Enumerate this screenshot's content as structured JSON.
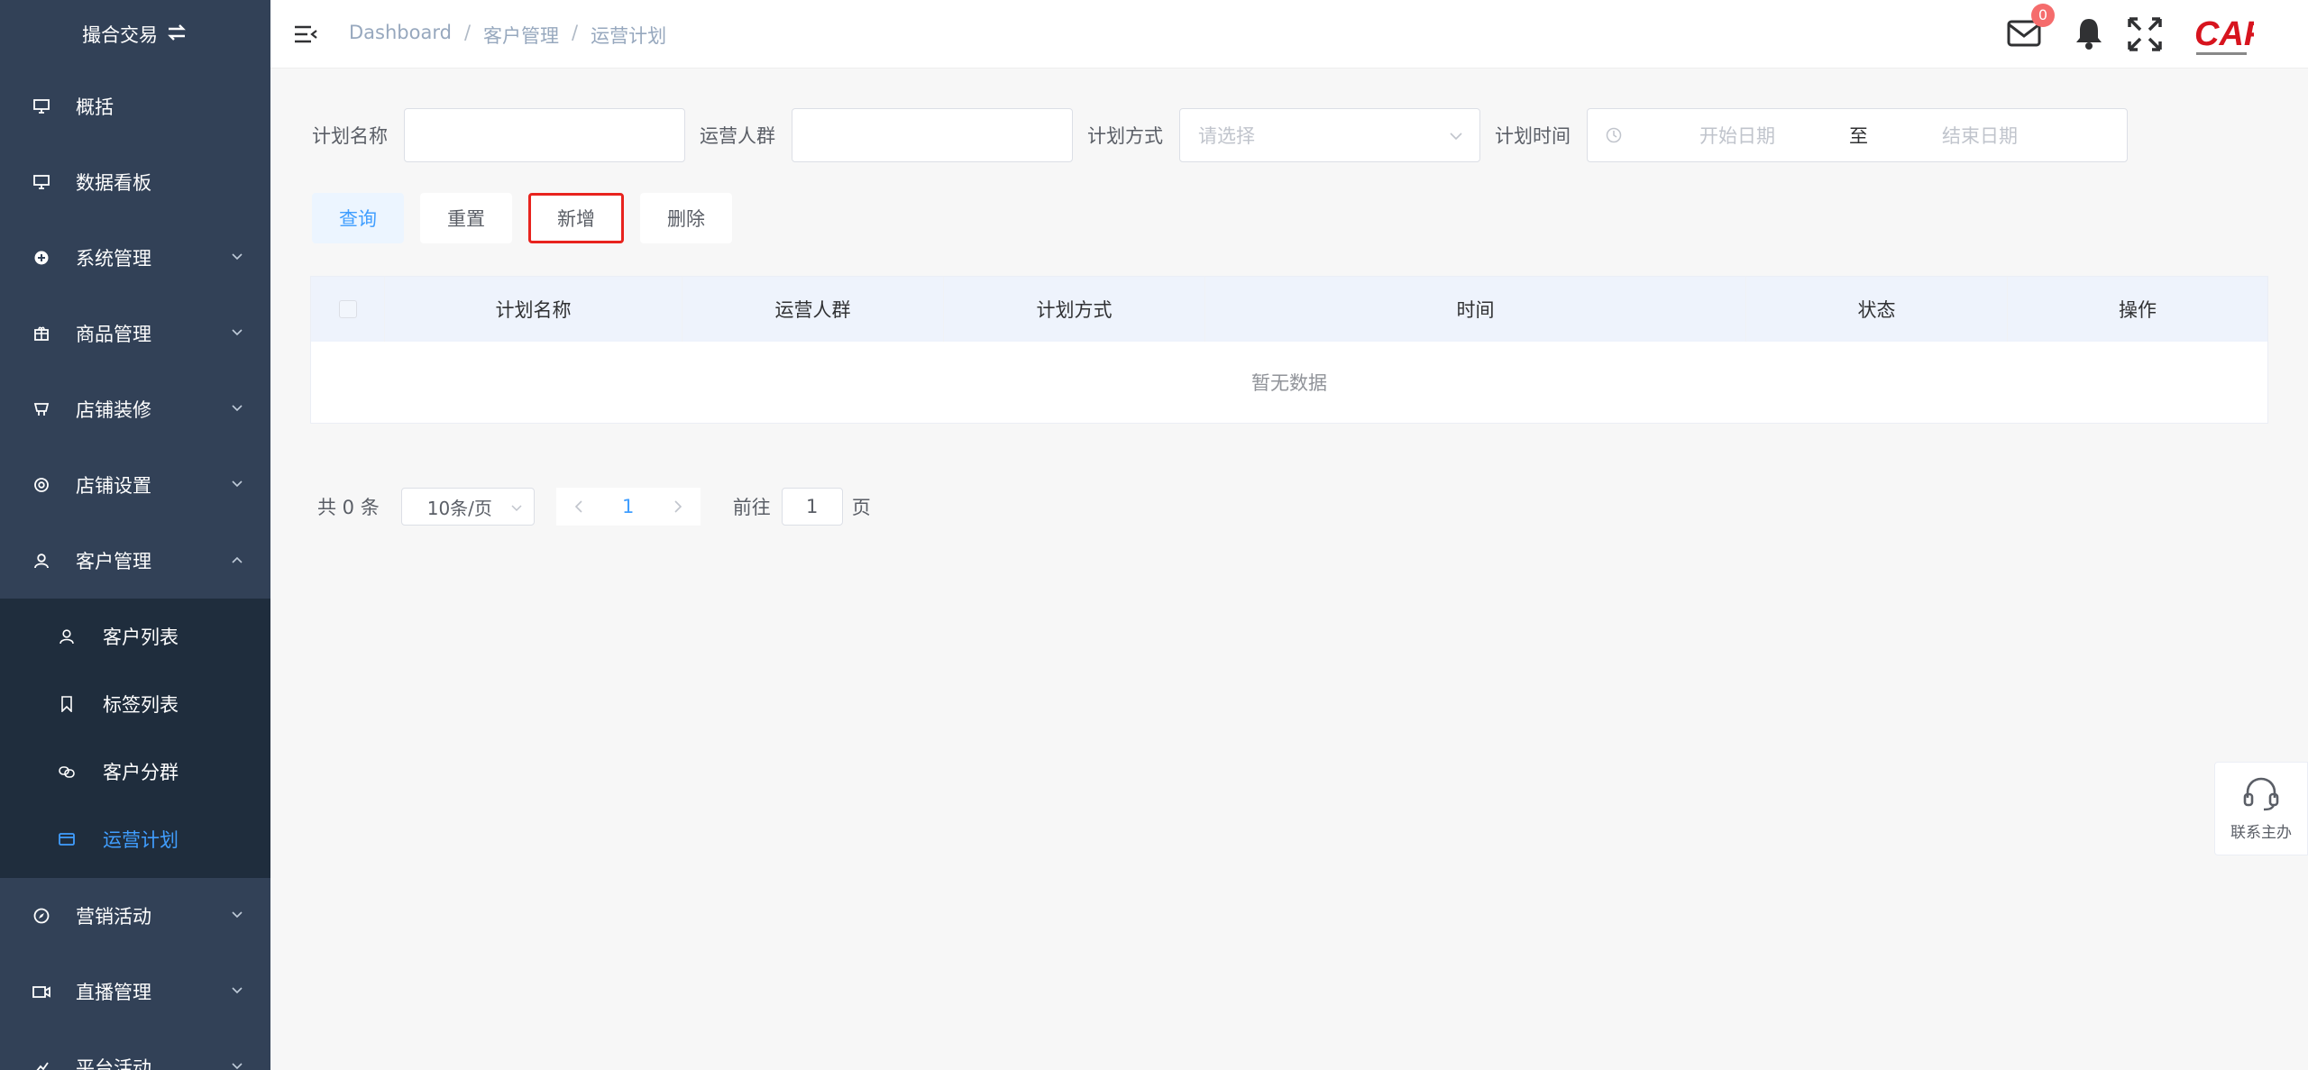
{
  "sidebar": {
    "brand": "撮合交易",
    "items": [
      {
        "label": "概括",
        "icon": "monitor-icon"
      },
      {
        "label": "数据看板",
        "icon": "monitor-icon"
      },
      {
        "label": "系统管理",
        "icon": "gear-icon"
      },
      {
        "label": "商品管理",
        "icon": "package-icon"
      },
      {
        "label": "店铺装修",
        "icon": "brush-icon"
      },
      {
        "label": "店铺设置",
        "icon": "settings-icon"
      },
      {
        "label": "客户管理",
        "icon": "user-icon"
      },
      {
        "label": "营销活动",
        "icon": "compass-icon"
      },
      {
        "label": "直播管理",
        "icon": "camera-icon"
      },
      {
        "label": "平台活动",
        "icon": "chart-icon"
      }
    ],
    "submenu": [
      {
        "label": "客户列表",
        "icon": "user-icon"
      },
      {
        "label": "标签列表",
        "icon": "bookmark-icon"
      },
      {
        "label": "客户分群",
        "icon": "link-icon"
      },
      {
        "label": "运营计划",
        "icon": "card-icon"
      }
    ]
  },
  "header": {
    "breadcrumb": [
      "Dashboard",
      "客户管理",
      "运营计划"
    ],
    "mail_badge": "0",
    "logo_text": "CAF"
  },
  "filters": {
    "plan_name_label": "计划名称",
    "plan_name_value": "",
    "audience_label": "运营人群",
    "audience_value": "",
    "method_label": "计划方式",
    "method_placeholder": "请选择",
    "time_label": "计划时间",
    "start_placeholder": "开始日期",
    "range_sep": "至",
    "end_placeholder": "结束日期"
  },
  "actions": {
    "query": "查询",
    "reset": "重置",
    "add": "新增",
    "delete": "删除"
  },
  "table": {
    "columns": [
      "计划名称",
      "运营人群",
      "计划方式",
      "时间",
      "状态",
      "操作"
    ],
    "empty_text": "暂无数据"
  },
  "pagination": {
    "total": "共 0 条",
    "page_size": "10条/页",
    "current_page": "1",
    "goto_label": "前往",
    "goto_value": "1",
    "goto_suffix": "页"
  },
  "contact": {
    "label": "联系主办"
  },
  "colors": {
    "sidebar_bg": "#324157",
    "submenu_bg": "#1f2d3d",
    "accent": "#409eff",
    "badge": "#f56c6c",
    "highlight_border": "#e8231e"
  }
}
